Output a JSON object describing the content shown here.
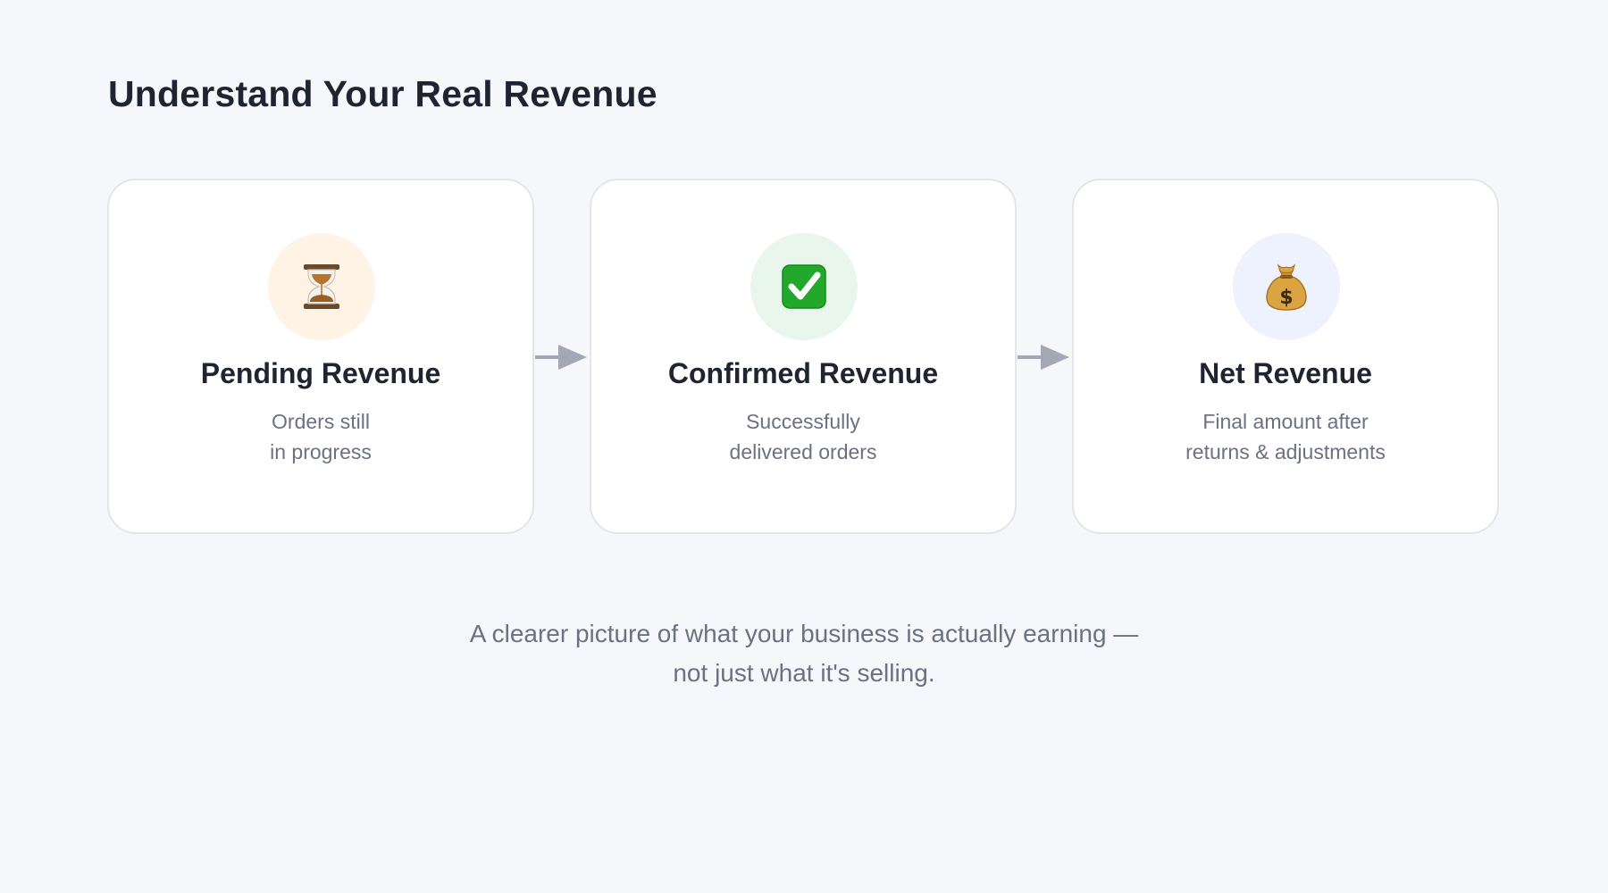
{
  "title": "Understand Your Real Revenue",
  "steps": [
    {
      "title": "Pending Revenue",
      "desc_line1": "Orders still",
      "desc_line2": "in progress",
      "icon": "hourglass-icon",
      "icon_bg": "#fff3e6"
    },
    {
      "title": "Confirmed Revenue",
      "desc_line1": "Successfully",
      "desc_line2": "delivered orders",
      "icon": "check-mark-icon",
      "icon_bg": "#e9f6ec"
    },
    {
      "title": "Net Revenue",
      "desc_line1": "Final amount after",
      "desc_line2": "returns & adjustments",
      "icon": "money-bag-icon",
      "icon_bg": "#eef1fe"
    }
  ],
  "caption": {
    "line1": "A clearer picture of what your business is actually earning —",
    "line2": "not just what it's selling."
  },
  "colors": {
    "background": "#f6f7fb",
    "card_border": "#e3e5ea",
    "arrow": "#a3a8b4",
    "title_text": "#1f2430",
    "body_text": "#6b7180"
  }
}
